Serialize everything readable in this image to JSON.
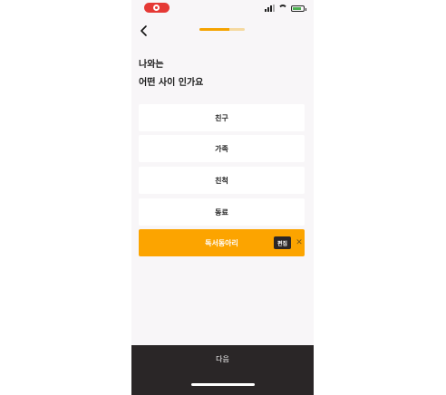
{
  "status_bar": {
    "recording_indicator": "record-icon",
    "icons": [
      "signal-icon",
      "wifi-icon",
      "battery-icon"
    ],
    "battery_color": "#4caf50"
  },
  "header": {
    "back_icon": "chevron-left-icon",
    "progress_fraction": 0.65
  },
  "question": {
    "line1": "나와는",
    "line2": "어떤 사이 인가요"
  },
  "options": [
    {
      "label": "친구",
      "selected": false
    },
    {
      "label": "가족",
      "selected": false
    },
    {
      "label": "친척",
      "selected": false
    },
    {
      "label": "동료",
      "selected": false
    },
    {
      "label": "독서동아리",
      "selected": true,
      "edit_label": "편집",
      "close_icon": "close-icon"
    }
  ],
  "colors": {
    "accent": "#fca400",
    "dark": "#2a2627",
    "background": "#f8f6f8"
  },
  "footer": {
    "next_label": "다음"
  }
}
